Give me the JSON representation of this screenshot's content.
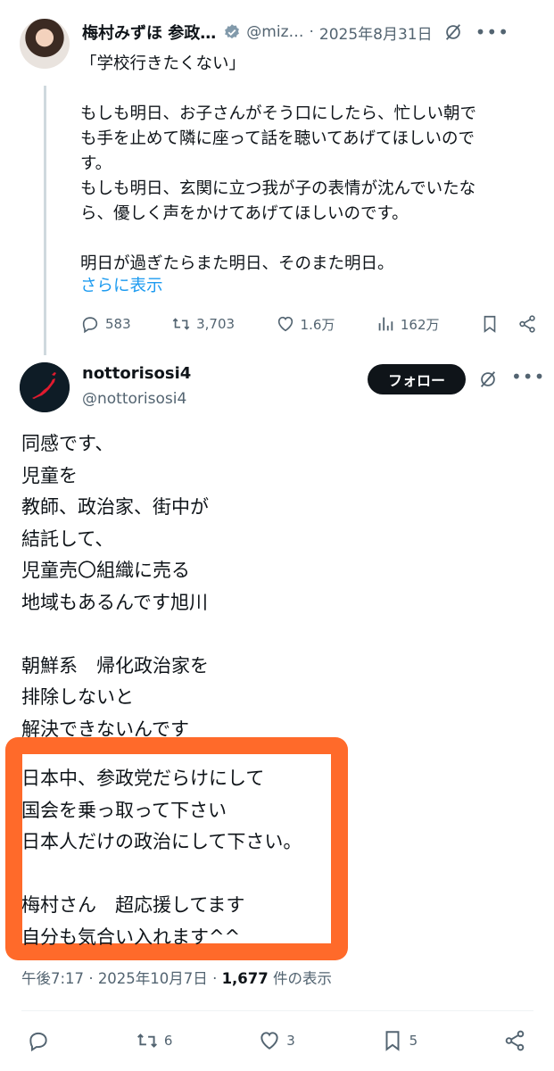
{
  "original_post": {
    "author_name": "梅村みずほ 参政…",
    "handle": "@miz…",
    "separator": "·",
    "date": "2025年8月31日",
    "body_lines": [
      "「学校行きたくない」",
      "",
      "もしも明日、お子さんがそう口にしたら、忙しい朝で",
      "も手を止めて隣に座って話を聴いてあげてほしいので",
      "す。",
      "もしも明日、玄関に立つ我が子の表情が沈んでいたな",
      "ら、優しく声をかけてあげてほしいのです。",
      "",
      "明日が過ぎたらまた明日、そのまた明日。"
    ],
    "show_more": "さらに表示",
    "stats": {
      "replies": "583",
      "reposts": "3,703",
      "likes": "1.6万",
      "views": "162万"
    }
  },
  "reply_post": {
    "author_name": "nottorisosi4",
    "handle": "@nottorisosi4",
    "follow_label": "フォロー",
    "body_text": "同感です、\n児童を\n教師、政治家、街中が\n結託して、\n児童売〇組織に売る\n地域もあるんです旭川\n\n朝鮮系　帰化政治家を\n排除しないと\n解決できないんです",
    "highlighted_text": "日本中、参政党だらけにして\n国会を乗っ取って下さい\n日本人だけの政治にして下さい。\n\n梅村さん　超応援してます\n自分も気合い入れます^^",
    "time": "午後7:17",
    "date": "2025年10月7日",
    "separator": "·",
    "views_count": "1,677",
    "views_label": "件の表示",
    "stats": {
      "reposts": "6",
      "likes": "3",
      "bookmarks": "5"
    }
  },
  "colors": {
    "accent": "#1d9bf0",
    "highlight": "#ff6a2a",
    "text": "#0f1419",
    "muted": "#536471"
  }
}
